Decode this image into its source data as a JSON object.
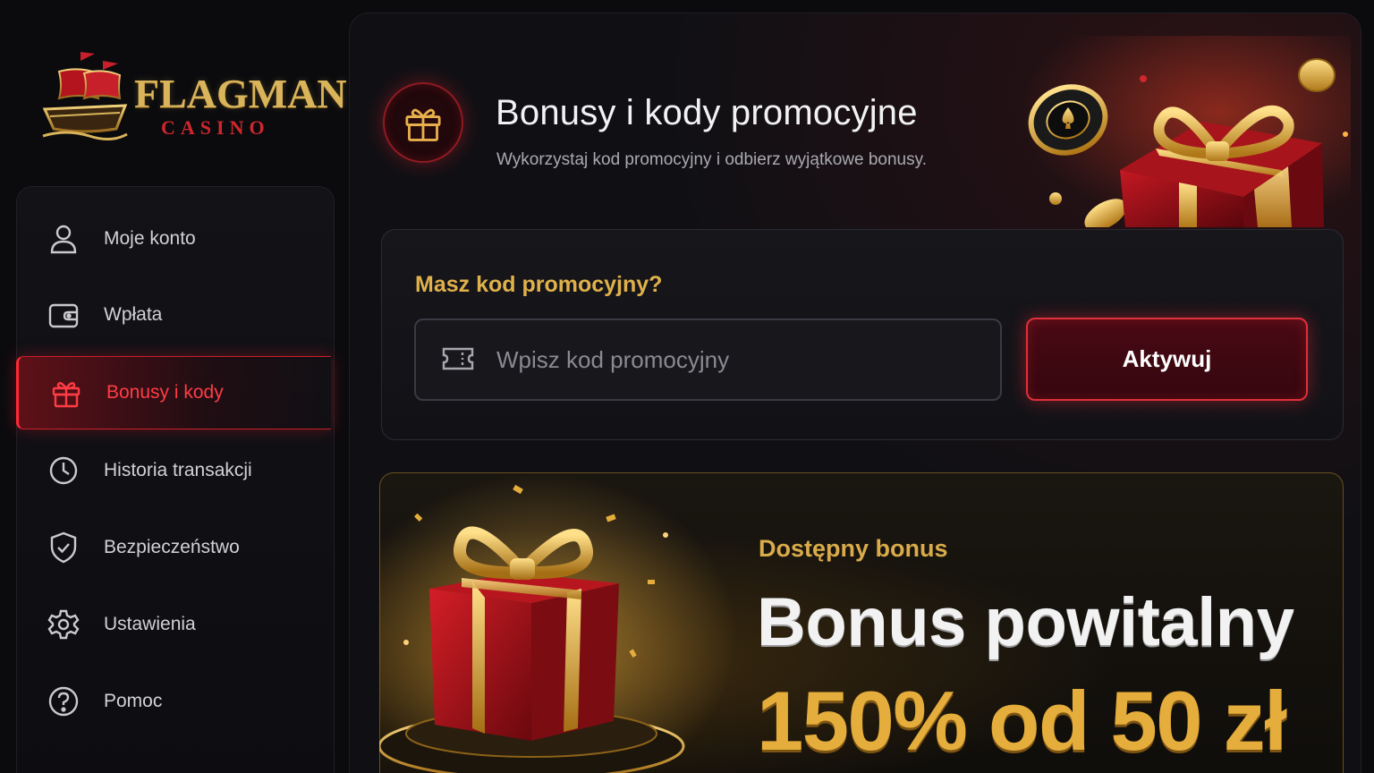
{
  "brand": {
    "name": "FLAGMAN",
    "sub": "CASINO",
    "colors": {
      "gold": "#d9b45a",
      "red": "#d0262e"
    }
  },
  "sidebar": {
    "items": [
      {
        "label": "Moje konto",
        "icon": "user-icon"
      },
      {
        "label": "Wpłata",
        "icon": "wallet-icon"
      },
      {
        "label": "Bonusy i kody",
        "icon": "gift-icon",
        "active": true
      },
      {
        "label": "Historia transakcji",
        "icon": "clock-icon"
      },
      {
        "label": "Bezpieczeństwo",
        "icon": "shield-check-icon"
      },
      {
        "label": "Ustawienia",
        "icon": "gear-icon"
      },
      {
        "label": "Pomoc",
        "icon": "help-icon"
      }
    ]
  },
  "header": {
    "title": "Bonusy i kody promocyjne",
    "subtitle": "Wykorzystaj kod promocyjny i odbierz wyjątkowe bonusy.",
    "icon": "gift-icon"
  },
  "promo": {
    "question": "Masz kod promocyjny?",
    "value": "",
    "placeholder": "Wpisz kod promocyjny",
    "icon": "ticket-icon",
    "button_label": "Aktywuj"
  },
  "bonus": {
    "eyebrow": "Dostępny bonus",
    "title": "Bonus powitalny",
    "offer": "150% od 50 zł"
  },
  "colors": {
    "accent_red": "#e0303a",
    "accent_gold": "#e0b14a",
    "background": "#0b0b0e"
  }
}
